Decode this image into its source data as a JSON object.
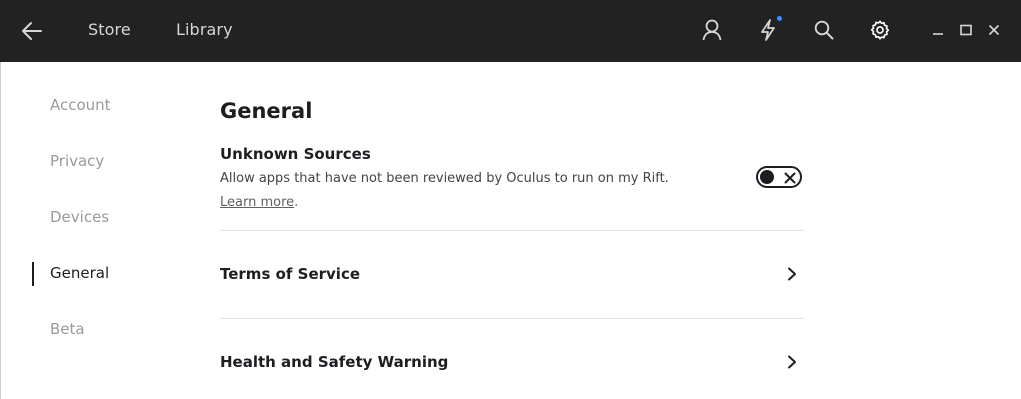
{
  "topbar": {
    "nav": {
      "store": "Store",
      "library": "Library"
    },
    "icons": {
      "back": "back-arrow-icon",
      "profile": "profile-icon",
      "notifications": "lightning-icon",
      "search": "search-icon",
      "settings": "gear-icon",
      "minimize": "minimize-icon",
      "maximize": "maximize-icon",
      "close": "close-icon"
    },
    "notification_dot_color": "#3b8cff"
  },
  "sidebar": {
    "items": [
      {
        "label": "Account"
      },
      {
        "label": "Privacy"
      },
      {
        "label": "Devices"
      },
      {
        "label": "General",
        "active": true
      },
      {
        "label": "Beta"
      }
    ]
  },
  "main": {
    "title": "General",
    "unknown_sources": {
      "title": "Unknown Sources",
      "description": "Allow apps that have not been reviewed by Oculus to run on my Rift.",
      "learn_more": "Learn more",
      "learn_more_suffix": ".",
      "toggle_enabled": false
    },
    "rows": [
      {
        "label": "Terms of Service"
      },
      {
        "label": "Health and Safety Warning"
      }
    ]
  },
  "colors": {
    "topbar_bg": "#222222",
    "text": "#1c1e21",
    "muted": "#9a9a9a"
  }
}
